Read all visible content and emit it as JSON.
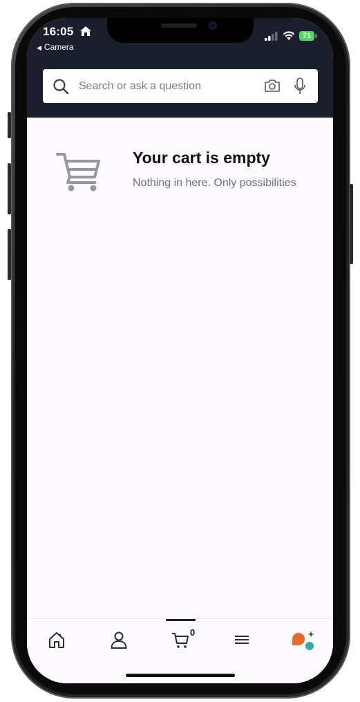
{
  "status_bar": {
    "time": "16:05",
    "back_app": "Camera",
    "battery": "71"
  },
  "search": {
    "placeholder": "Search or ask a question"
  },
  "cart": {
    "title": "Your cart is empty",
    "subtitle": "Nothing in here. Only possibilities"
  },
  "bottom_nav": {
    "items": [
      "home",
      "account",
      "cart",
      "menu",
      "assistant"
    ],
    "active": "cart",
    "cart_count": "0"
  },
  "colors": {
    "header_bg": "#1b1e2c",
    "page_bg": "#fdfbfd",
    "battery": "#4cd964",
    "assistant_orange": "#e8692b",
    "assistant_teal": "#3ca3ad"
  }
}
